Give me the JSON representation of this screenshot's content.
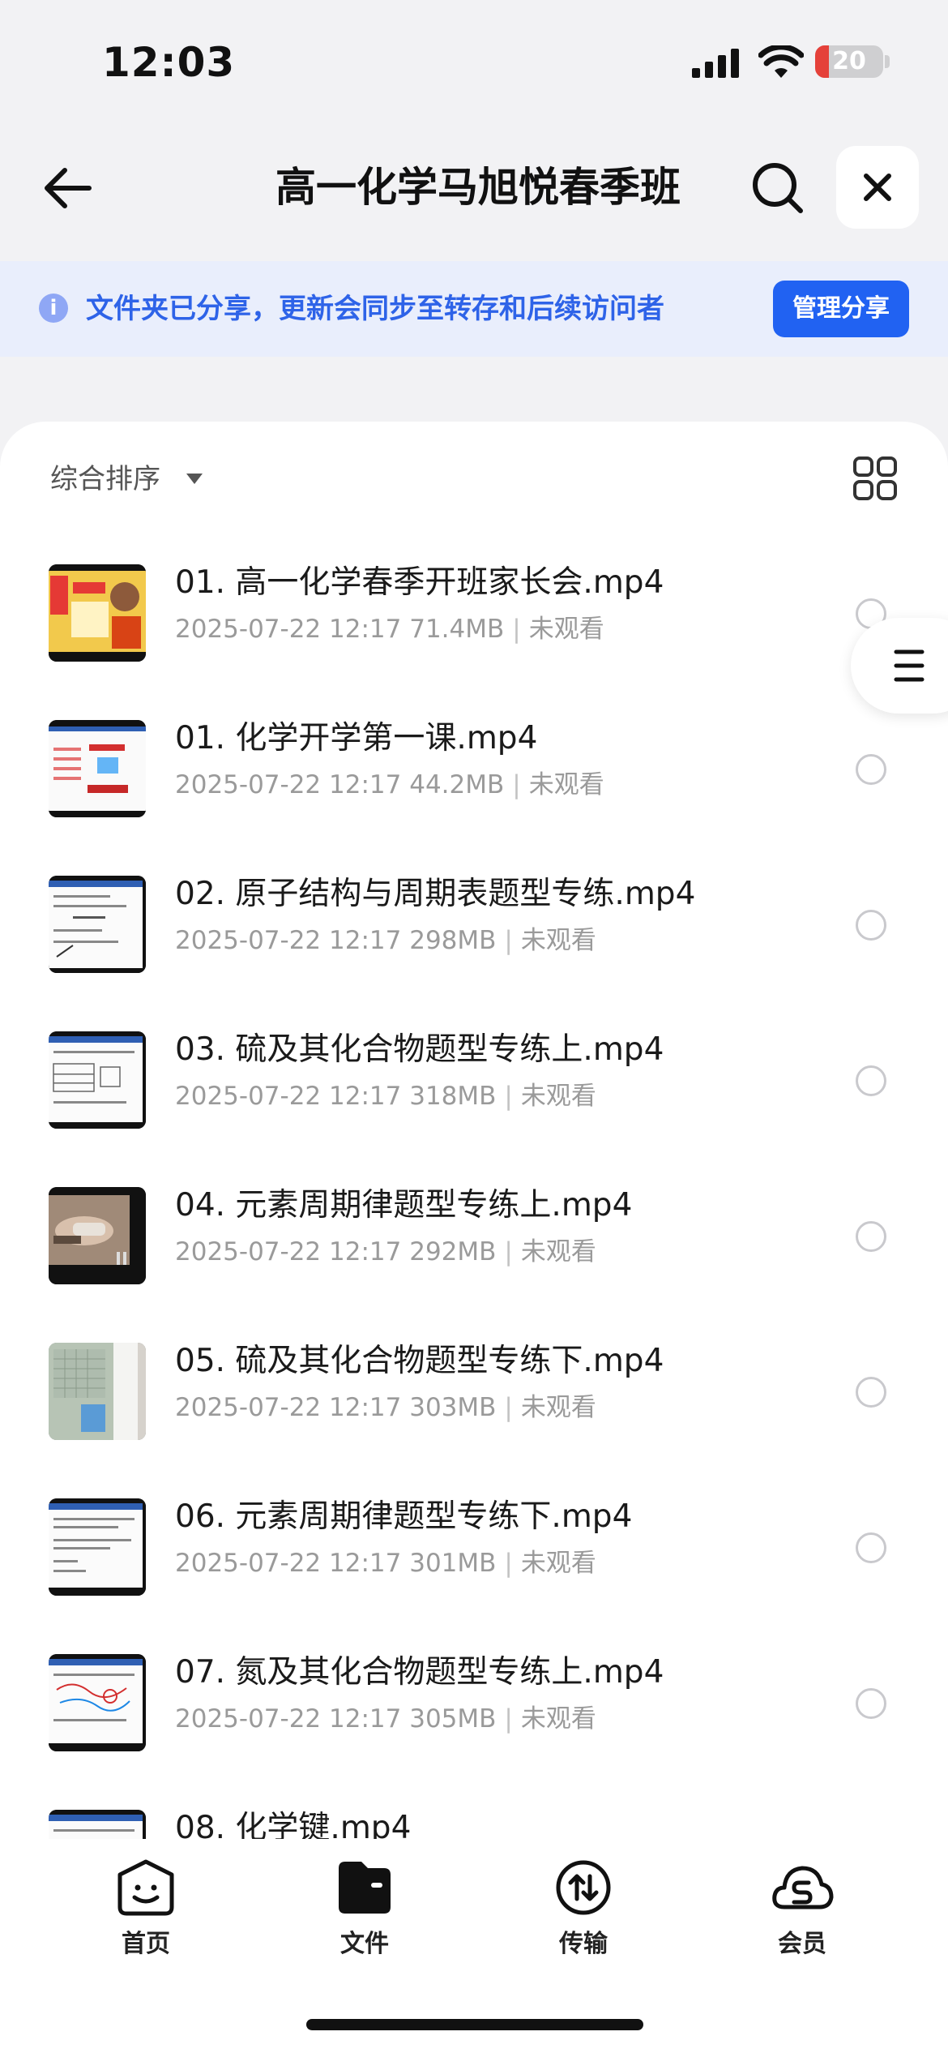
{
  "status_bar": {
    "time": "12:03",
    "battery": "20",
    "battery_level": 0.2
  },
  "nav": {
    "title": "高一化学马旭悦春季班"
  },
  "banner": {
    "text": "文件夹已分享，更新会同步至转存和后续访问者",
    "button": "管理分享"
  },
  "sort": {
    "label": "综合排序"
  },
  "files": [
    {
      "name": "01. 高一化学春季开班家长会.mp4",
      "date": "2025-07-22 12:17",
      "size": "71.4MB",
      "status": "未观看"
    },
    {
      "name": "01. 化学开学第一课.mp4",
      "date": "2025-07-22 12:17",
      "size": "44.2MB",
      "status": "未观看"
    },
    {
      "name": "02. 原子结构与周期表题型专练.mp4",
      "date": "2025-07-22 12:17",
      "size": "298MB",
      "status": "未观看"
    },
    {
      "name": "03. 硫及其化合物题型专练上.mp4",
      "date": "2025-07-22 12:17",
      "size": "318MB",
      "status": "未观看"
    },
    {
      "name": "04. 元素周期律题型专练上.mp4",
      "date": "2025-07-22 12:17",
      "size": "292MB",
      "status": "未观看"
    },
    {
      "name": "05. 硫及其化合物题型专练下.mp4",
      "date": "2025-07-22 12:17",
      "size": "303MB",
      "status": "未观看"
    },
    {
      "name": "06. 元素周期律题型专练下.mp4",
      "date": "2025-07-22 12:17",
      "size": "301MB",
      "status": "未观看"
    },
    {
      "name": "07. 氮及其化合物题型专练上.mp4",
      "date": "2025-07-22 12:17",
      "size": "305MB",
      "status": "未观看"
    },
    {
      "name": "08. 化学键.mp4",
      "date": "",
      "size": "",
      "status": ""
    }
  ],
  "tabs": [
    {
      "label": "首页",
      "icon": "home-smile-icon"
    },
    {
      "label": "文件",
      "icon": "folder-icon"
    },
    {
      "label": "传输",
      "icon": "transfer-icon"
    },
    {
      "label": "会员",
      "icon": "member-cloud-icon"
    }
  ],
  "colors": {
    "accent": "#2162f2",
    "banner_bg": "#e9eefc",
    "banner_text": "#2e63e8",
    "battery_low": "#e5413a"
  }
}
